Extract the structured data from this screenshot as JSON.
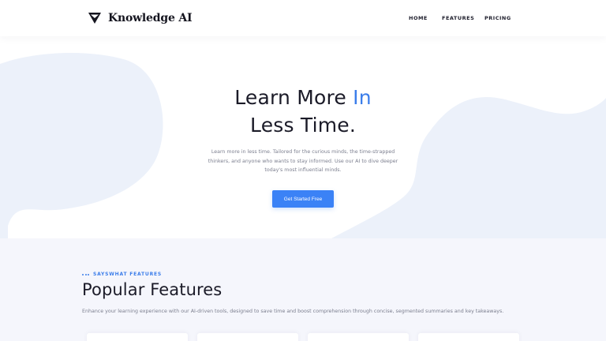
{
  "brand": {
    "name": "Knowledge AI",
    "logo_icon": "triangle-shield-icon"
  },
  "nav": {
    "items": [
      {
        "label": "HOME"
      },
      {
        "label": "FEATURES"
      },
      {
        "label": "PRICING"
      }
    ]
  },
  "hero": {
    "title_line1": "Learn More ",
    "title_accent": "In",
    "title_line2": "Less Time.",
    "description": "Learn more in less time. Tailored for the curious minds, the time-strapped thinkers, and anyone who wants to stay informed. Use our AI to dive deeper today's most influential minds.",
    "cta_label": "Get Started Free"
  },
  "features": {
    "eyebrow": "SAYSWHAT FEATURES",
    "title": "Popular Features",
    "description": "Enhance your learning experience with our AI-driven tools, designed to save time and boost comprehension through concise, segmented summaries and key takeaways."
  },
  "colors": {
    "accent": "#3b82f6",
    "blob": "#ecf1fa",
    "section_bg": "#f5f6fc",
    "text_dark": "#1b1b28"
  }
}
